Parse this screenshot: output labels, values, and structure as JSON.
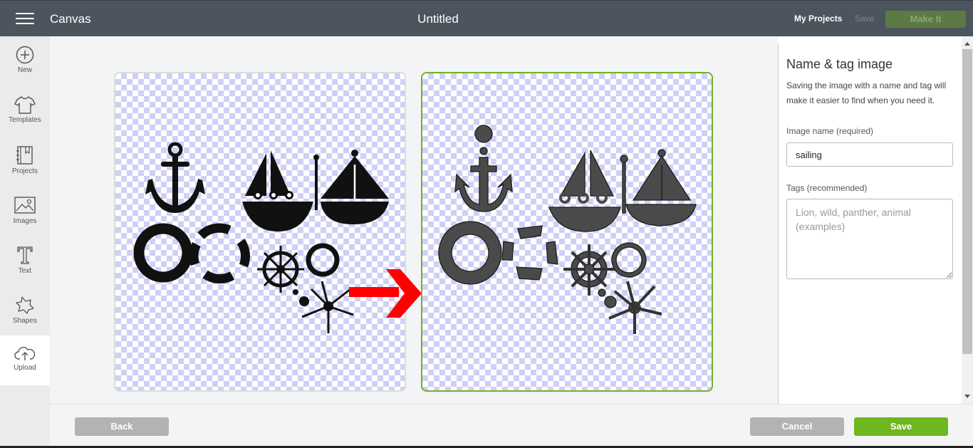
{
  "header": {
    "app_title": "Canvas",
    "doc_title": "Untitled",
    "my_projects": "My Projects",
    "save": "Save",
    "make_it": "Make It"
  },
  "sidebar": {
    "items": [
      {
        "label": "New",
        "icon": "plus-circle-icon"
      },
      {
        "label": "Templates",
        "icon": "tshirt-icon"
      },
      {
        "label": "Projects",
        "icon": "notebook-icon"
      },
      {
        "label": "Images",
        "icon": "image-icon"
      },
      {
        "label": "Text",
        "icon": "text-icon"
      },
      {
        "label": "Shapes",
        "icon": "shapes-icon"
      },
      {
        "label": "Upload",
        "icon": "cloud-upload-icon"
      }
    ],
    "active": "Upload"
  },
  "right_panel": {
    "title": "Name & tag image",
    "description": "Saving the image with a name and tag will make it easier to find when you need it.",
    "name_label": "Image name (required)",
    "name_value": "sailing",
    "tags_label": "Tags (recommended)",
    "tags_placeholder": "Lion, wild, panther, animal (examples)"
  },
  "footer": {
    "back": "Back",
    "cancel": "Cancel",
    "save": "Save"
  },
  "colors": {
    "header_bg": "#4c555e",
    "accent_green": "#6fb71e",
    "selected_border": "#6fb22b",
    "arrow_red": "#ff0000",
    "checker": "#cfd0f5"
  }
}
